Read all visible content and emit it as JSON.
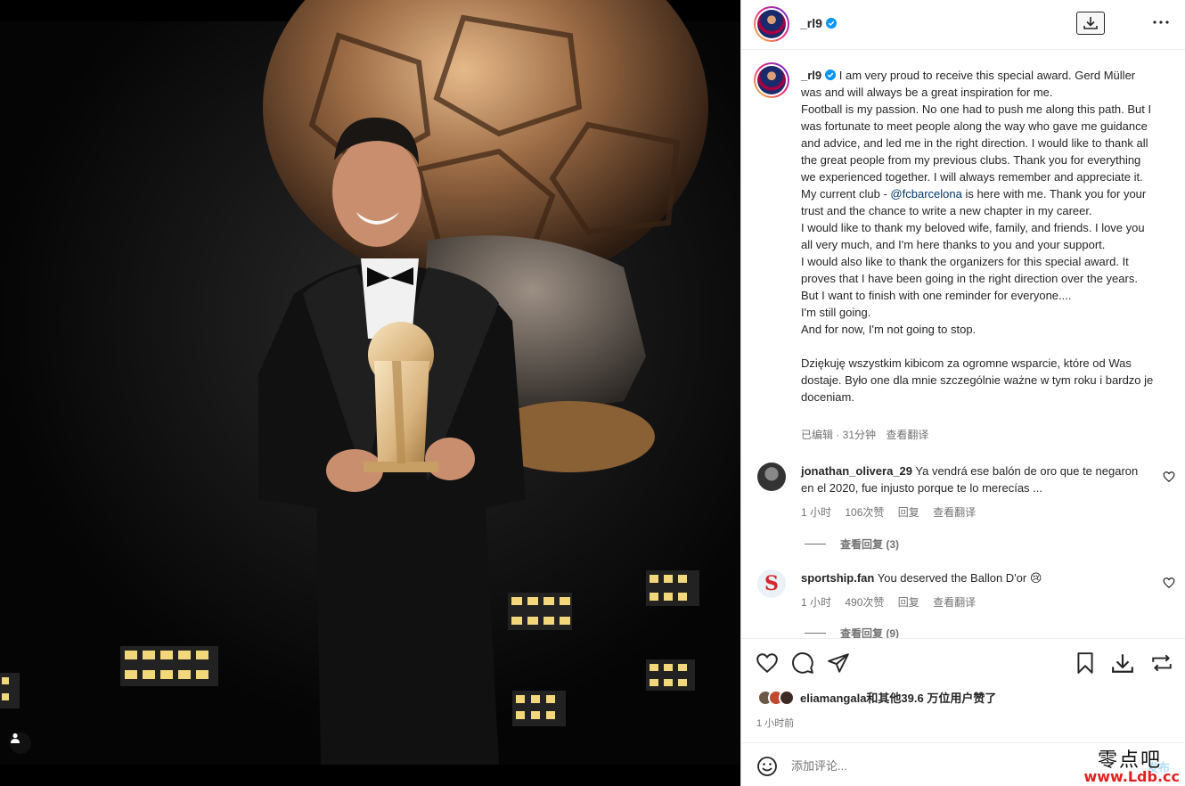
{
  "post": {
    "username": "_rl9",
    "caption_username": "_rl9",
    "caption_lines": [
      "I am very proud to receive this special award. Gerd Müller was and will always be a great inspiration for me.",
      "Football is my passion. No one had to push me along this path. But I was fortunate to meet people along the way who gave me guidance and advice, and led me in the right direction. I would like to thank all the great people from my previous clubs. Thank you for everything we experienced together. I will always remember and appreciate it."
    ],
    "club_line_prefix": "My current club - ",
    "club_mention": "@fcbarcelona",
    "club_line_suffix": " is here with me. Thank you for your trust and the chance to write a new chapter in my career.",
    "caption_lines_2": [
      "I would like to thank my beloved wife, family, and friends. I love you all very much, and I'm here thanks to you and your support.",
      "I would also like to thank the organizers for this special award. It proves that I have been going in the right direction over the years. But I want to finish with one reminder for everyone....",
      "I'm still going.",
      "And for now, I'm not going to stop."
    ],
    "caption_polish": "Dziękuję wszystkim kibicom za ogromne wsparcie, które od Was dostaje. Było one dla mnie szczególnie ważne w tym roku i bardzo je doceniam.",
    "caption_meta": {
      "edited": "已编辑 · 31分钟",
      "translate": "查看翻译"
    }
  },
  "comments": [
    {
      "username": "jonathan_olivera_29",
      "text": "Ya vendrá ese balón de oro que te negaron en el 2020, fue injusto porque te lo merecías ...",
      "time": "1 小时",
      "likes": "106次赞",
      "reply": "回复",
      "translate": "查看翻译",
      "view_replies": "查看回复 (3)"
    },
    {
      "username": "sportship.fan",
      "text": "You deserved the Ballon D'or 😢",
      "time": "1 小时",
      "likes": "490次赞",
      "reply": "回复",
      "translate": "查看翻译",
      "view_replies": "查看回复 (9)"
    }
  ],
  "likes": {
    "text": "eliamangala和其他39.6 万位用户赞了",
    "time": "1 小时前"
  },
  "comment_box": {
    "placeholder": "添加评论...",
    "post_label": "发布"
  },
  "watermark": {
    "cn": "零点吧",
    "url": "www.Ldb.cc"
  },
  "icons": {
    "verified": "verified-badge-icon",
    "download": "download-icon",
    "more": "more-options-icon",
    "like": "heart-icon",
    "comment": "comment-icon",
    "share": "share-icon",
    "save": "bookmark-icon",
    "download_action": "download-icon",
    "repost": "repost-icon",
    "emoji": "emoji-icon",
    "user_tag": "user-icon"
  },
  "colors": {
    "verified": "#0095f6",
    "mention": "#00376b",
    "muted": "#737373",
    "post_disabled": "#b2dffc",
    "watermark_red": "#e02020"
  }
}
